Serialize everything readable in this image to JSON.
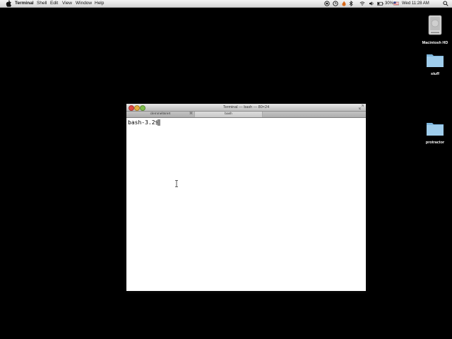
{
  "menubar": {
    "app_name": "Terminal",
    "items": [
      "Shell",
      "Edit",
      "View",
      "Window",
      "Help"
    ],
    "battery": "30%",
    "datetime": "Wed 11:28 AM"
  },
  "desktop": {
    "icons": [
      {
        "label": "Macintosh HD",
        "icon": "hard-drive-icon"
      },
      {
        "label": "stuff",
        "icon": "folder-icon"
      },
      {
        "label": "protractor",
        "icon": "folder-icon"
      }
    ]
  },
  "window": {
    "title": "Terminal — bash — 80×24",
    "tabs": [
      {
        "label": "clemmeltsrert",
        "active": false
      },
      {
        "label": "bash",
        "active": true
      }
    ]
  },
  "terminal": {
    "prompt": "bash-3.2$"
  },
  "colors": {
    "desktop": "#000000",
    "terminal_bg": "#ffffff",
    "folder": "#8fc4e6",
    "close": "#e24b45",
    "minimize": "#e5b13c",
    "zoom": "#7fbe4a"
  }
}
